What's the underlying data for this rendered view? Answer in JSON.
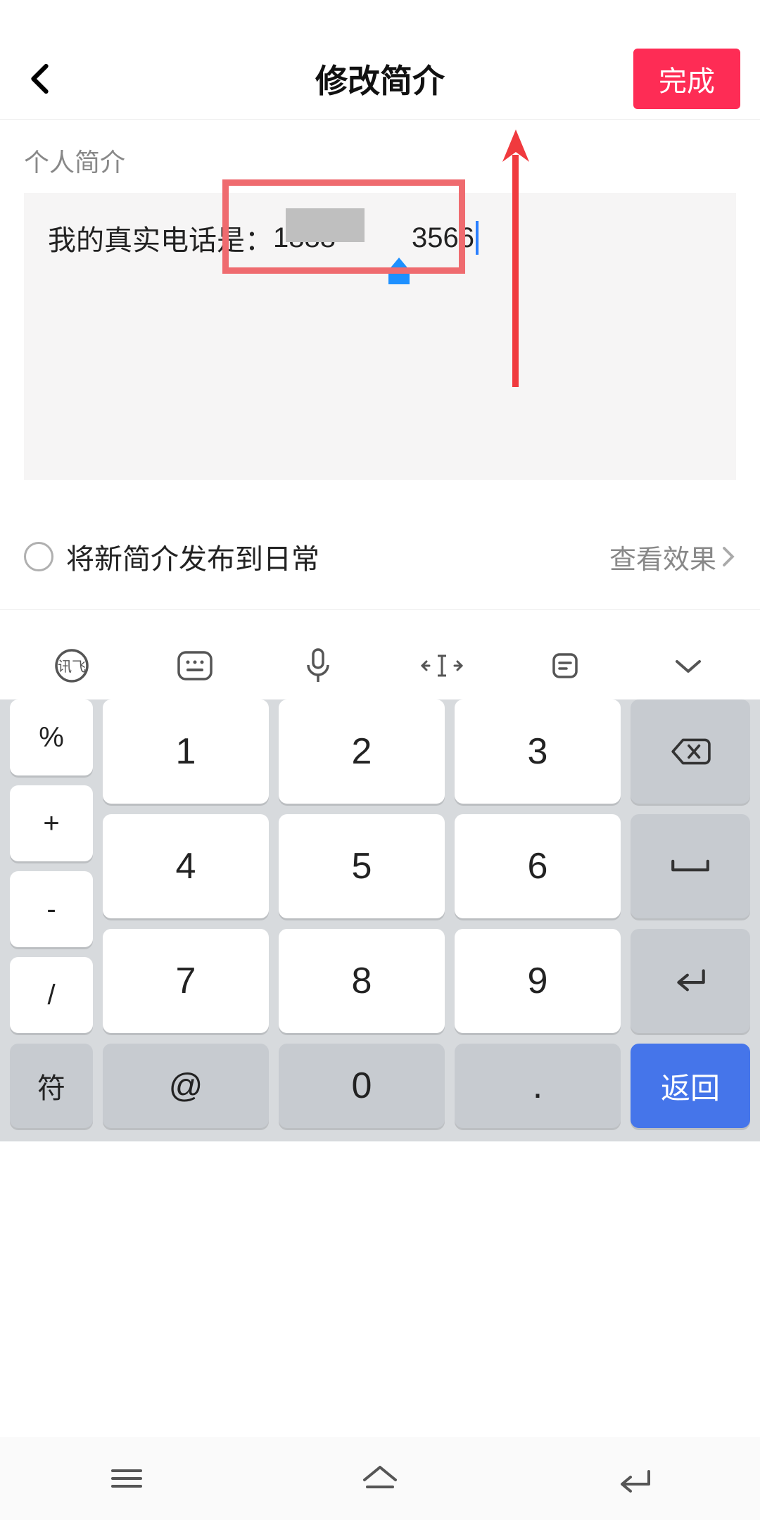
{
  "header": {
    "title": "修改简介",
    "done_label": "完成"
  },
  "section": {
    "label": "个人简介"
  },
  "bio": {
    "prefix": "我的真实电话是：",
    "phone_visible_left": "1888",
    "phone_visible_right": "3566"
  },
  "publish": {
    "label": "将新简介发布到日常",
    "preview": "查看效果"
  },
  "keypad": {
    "side": [
      "%",
      "+",
      "-",
      "/"
    ],
    "nums": [
      "1",
      "2",
      "3",
      "4",
      "5",
      "6",
      "7",
      "8",
      "9"
    ],
    "sym": "符",
    "at": "@",
    "zero": "0",
    "dot": ".",
    "return": "返回"
  }
}
